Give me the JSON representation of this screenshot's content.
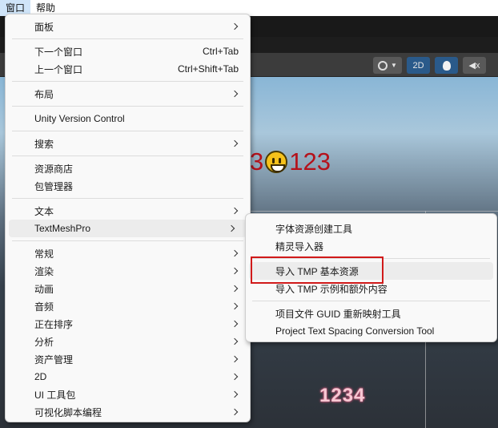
{
  "menubar": {
    "items": [
      "窗口",
      "帮助"
    ]
  },
  "toolbar": {
    "btn_2d": "2D"
  },
  "scene": {
    "text_123": "123",
    "text_3": "3",
    "text_1234": "1234"
  },
  "main_menu": {
    "items": [
      {
        "label": "面板",
        "submenu": true
      },
      {
        "label": "下一个窗口",
        "shortcut": "Ctrl+Tab"
      },
      {
        "label": "上一个窗口",
        "shortcut": "Ctrl+Shift+Tab"
      },
      {
        "label": "布局",
        "submenu": true
      },
      {
        "label": "Unity Version Control"
      },
      {
        "label": "搜索",
        "submenu": true
      },
      {
        "label": "资源商店"
      },
      {
        "label": "包管理器"
      },
      {
        "label": "文本",
        "submenu": true
      },
      {
        "label": "TextMeshPro",
        "submenu": true,
        "highlighted": true
      },
      {
        "label": "常规",
        "submenu": true
      },
      {
        "label": "渲染",
        "submenu": true
      },
      {
        "label": "动画",
        "submenu": true
      },
      {
        "label": "音频",
        "submenu": true
      },
      {
        "label": "正在排序",
        "submenu": true
      },
      {
        "label": "分析",
        "submenu": true
      },
      {
        "label": "资产管理",
        "submenu": true
      },
      {
        "label": "2D",
        "submenu": true
      },
      {
        "label": "UI 工具包",
        "submenu": true
      },
      {
        "label": "可视化脚本编程",
        "submenu": true
      }
    ]
  },
  "sub_menu": {
    "items": [
      {
        "label": "字体资源创建工具"
      },
      {
        "label": "精灵导入器"
      },
      {
        "label": "导入 TMP 基本资源",
        "highlighted": true
      },
      {
        "label": "导入 TMP 示例和额外内容"
      },
      {
        "label": "项目文件 GUID 重新映射工具"
      },
      {
        "label": "Project Text Spacing Conversion Tool"
      }
    ]
  },
  "colors": {
    "highlight_box": "#d11a1a",
    "emoji_text": "#b5121b",
    "menu_bg": "#f9f9f9"
  }
}
